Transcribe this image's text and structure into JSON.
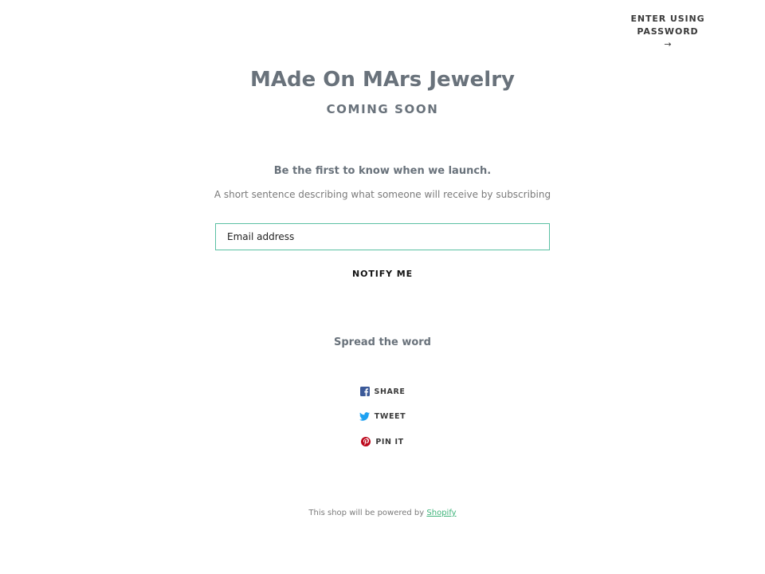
{
  "header": {
    "enter_password_label": "ENTER USING PASSWORD",
    "arrow": "→"
  },
  "hero": {
    "shop_title": "MAde On MArs Jewelry",
    "status": "COMING SOON"
  },
  "newsletter": {
    "heading": "Be the first to know when we launch.",
    "description": "A short sentence describing what someone will receive by subscribing",
    "email_placeholder": "Email address",
    "submit_label": "NOTIFY ME",
    "field_border_color": "#5bc0a3"
  },
  "social": {
    "heading": "Spread the word",
    "items": [
      {
        "label": "SHARE",
        "icon": "facebook-icon",
        "color": "#3b5998"
      },
      {
        "label": "TWEET",
        "icon": "twitter-icon",
        "color": "#1da1f2"
      },
      {
        "label": "PIN IT",
        "icon": "pinterest-icon",
        "color": "#bd081c"
      }
    ]
  },
  "footer": {
    "text": "This shop will be powered by",
    "link_label": "Shopify",
    "link_color": "#3fb37a"
  }
}
